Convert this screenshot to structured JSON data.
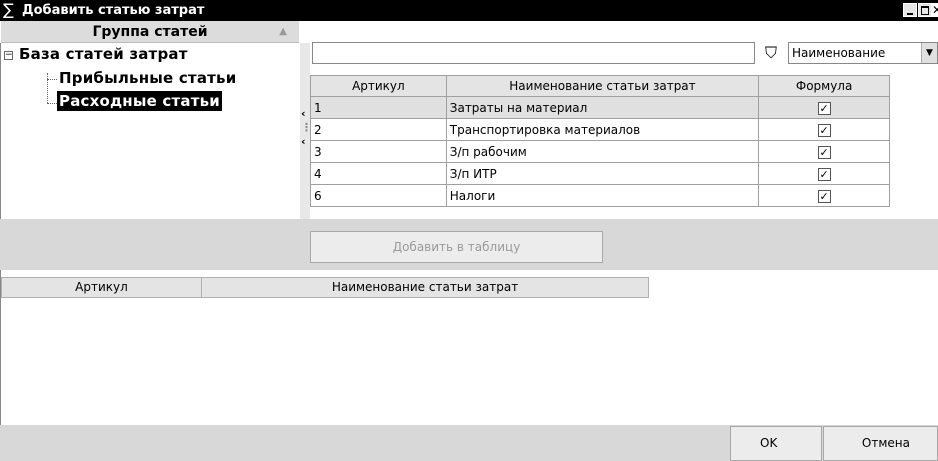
{
  "window": {
    "title": "Добавить статью затрат",
    "title_icon": "sigma-icon"
  },
  "tree": {
    "header": "Группа статей",
    "root": "База статей затрат",
    "children": [
      "Прибыльные статьи",
      "Расходные статьи"
    ],
    "selected": "Расходные статьи"
  },
  "search": {
    "value": "",
    "field": "Наименование"
  },
  "grid": {
    "columns": [
      "Артикул",
      "Наименование статьи затрат",
      "Формула"
    ],
    "rows": [
      {
        "art": "1",
        "name": "Затраты на материал",
        "formula": true
      },
      {
        "art": "2",
        "name": "Транспортировка материалов",
        "formula": true
      },
      {
        "art": "3",
        "name": "З/п рабочим",
        "formula": true
      },
      {
        "art": "4",
        "name": "З/п ИТР",
        "formula": true
      },
      {
        "art": "6",
        "name": "Налоги",
        "formula": true
      }
    ]
  },
  "add_button": "Добавить в таблицу",
  "lower_grid": {
    "columns": [
      "Артикул",
      "Наименование статьи затрат"
    ]
  },
  "footer": {
    "ok": "OK",
    "cancel": "Отмена"
  }
}
